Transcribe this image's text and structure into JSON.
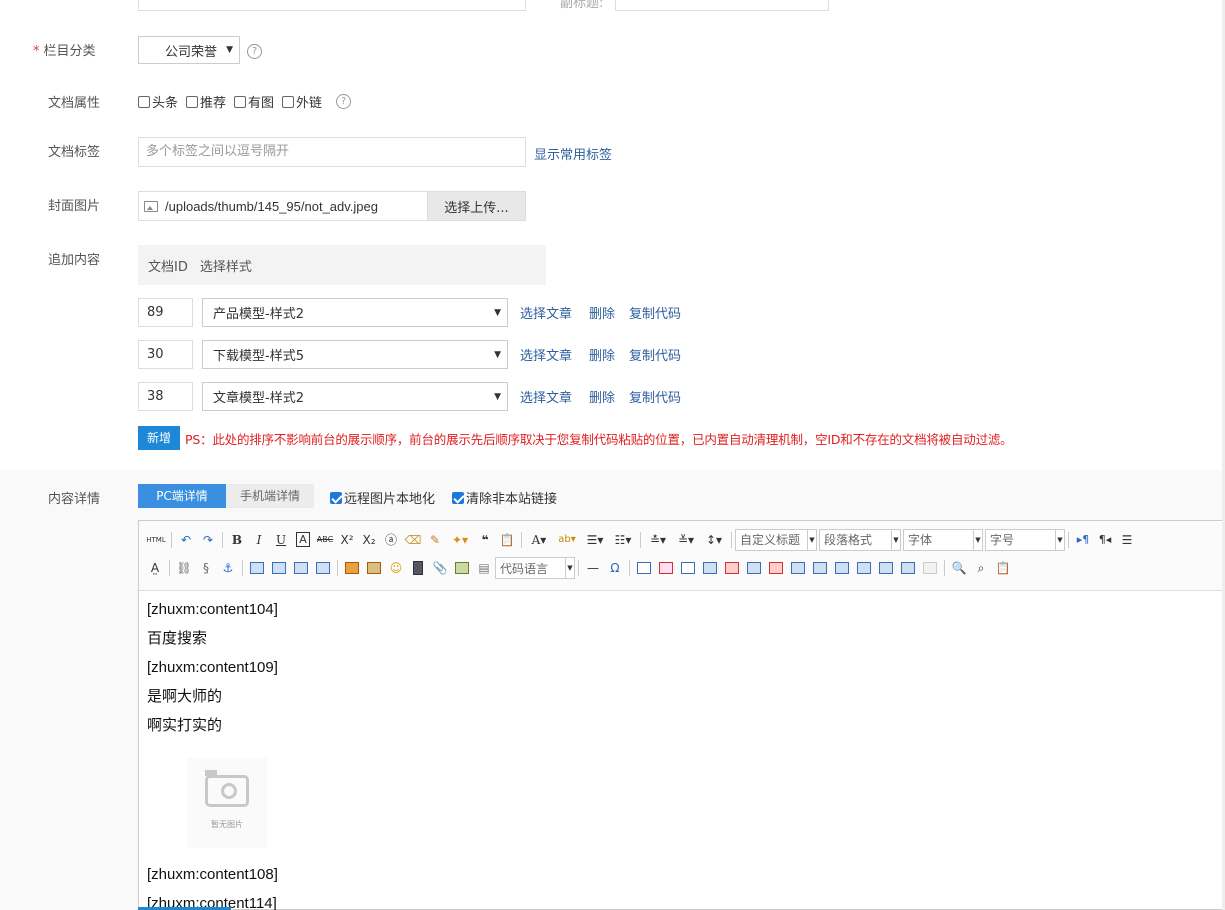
{
  "top": {
    "title_value": "",
    "subtitle_label": "副标题:"
  },
  "category": {
    "label": "栏目分类",
    "required_mark": "*",
    "selected": "公司荣誉",
    "help": "?"
  },
  "attributes": {
    "label": "文档属性",
    "options": [
      "头条",
      "推荐",
      "有图",
      "外链"
    ],
    "help": "?"
  },
  "tags": {
    "label": "文档标签",
    "placeholder": "多个标签之间以逗号隔开",
    "show_common": "显示常用标签"
  },
  "cover": {
    "label": "封面图片",
    "path": "/uploads/thumb/145_95/not_adv.jpeg",
    "upload_btn": "选择上传..."
  },
  "append": {
    "label": "追加内容",
    "col_id": "文档ID",
    "col_style": "选择样式",
    "rows": [
      {
        "id": "89",
        "style": "产品模型-样式2"
      },
      {
        "id": "30",
        "style": "下载模型-样式5"
      },
      {
        "id": "38",
        "style": "文章模型-样式2"
      }
    ],
    "actions": [
      "选择文章",
      "删除",
      "复制代码"
    ],
    "add_btn": "新增",
    "note": "PS：此处的排序不影响前台的展示顺序，前台的展示先后顺序取决于您复制代码粘贴的位置，已内置自动清理机制，空ID和不存在的文档将被自动过滤。"
  },
  "content": {
    "label": "内容详情",
    "tabs": [
      "PC端详情",
      "手机端详情"
    ],
    "opt_localize": "远程图片本地化",
    "opt_clean_links": "清除非本站链接",
    "toolbar": {
      "html": "HTML",
      "custom_title": "自定义标题",
      "paragraph": "段落格式",
      "font": "字体",
      "size": "字号",
      "code_lang": "代码语言"
    },
    "doc_lines": [
      "[zhuxm:content104]",
      "百度搜索",
      "[zhuxm:content109]",
      "是啊大师的",
      "啊实打实的"
    ],
    "image_caption": "暂无图片",
    "doc_lines_after": [
      "[zhuxm:content108]",
      "[zhuxm:content114]"
    ]
  },
  "colors": {
    "accent": "#1e88d8",
    "link": "#2d5e9f",
    "note": "#e02020",
    "tab_active": "#3a8fe0"
  }
}
